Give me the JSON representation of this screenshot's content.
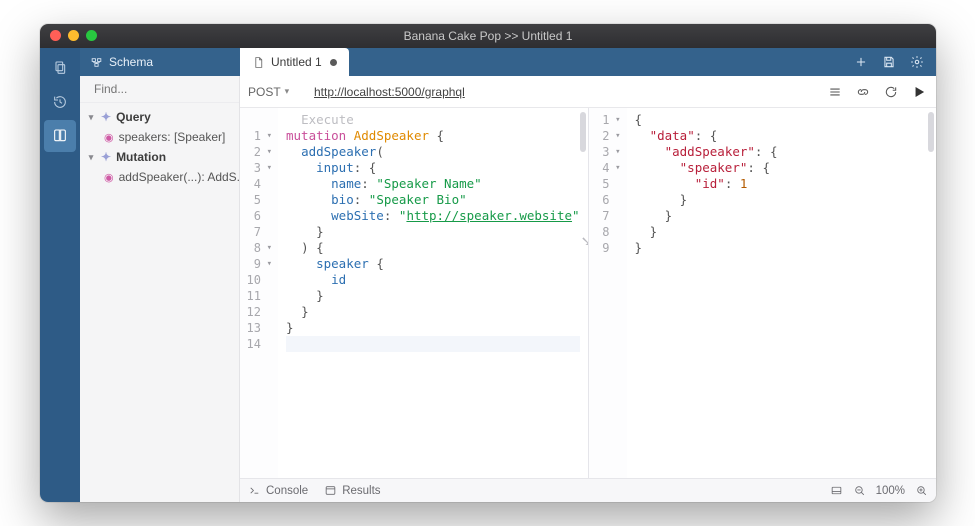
{
  "window": {
    "title": "Banana Cake Pop >> Untitled 1"
  },
  "tabs": {
    "schema_label": "Schema",
    "doc_label": "Untitled 1"
  },
  "sidebar": {
    "search_placeholder": "Find...",
    "groups": [
      {
        "label": "Query",
        "children": [
          {
            "label": "speakers: [Speaker]"
          }
        ]
      },
      {
        "label": "Mutation",
        "children": [
          {
            "label": "addSpeaker(...): AddS..."
          }
        ]
      }
    ]
  },
  "request": {
    "method": "POST",
    "url": "http://localhost:5000/graphql"
  },
  "editor": {
    "execute_hint": "Execute",
    "query_lines": 14,
    "query": {
      "operation_kw": "mutation",
      "operation_name": "AddSpeaker",
      "root_field": "addSpeaker",
      "input_arg": "input",
      "args": {
        "name": "Speaker Name",
        "bio": "Speaker Bio",
        "webSite": "http://speaker.website"
      },
      "selection": [
        "speaker",
        "id"
      ]
    }
  },
  "response": {
    "lines": 9,
    "data": {
      "addSpeaker": {
        "speaker": {
          "id": 1
        }
      }
    }
  },
  "statusbar": {
    "console": "Console",
    "results": "Results",
    "zoom": "100%"
  }
}
